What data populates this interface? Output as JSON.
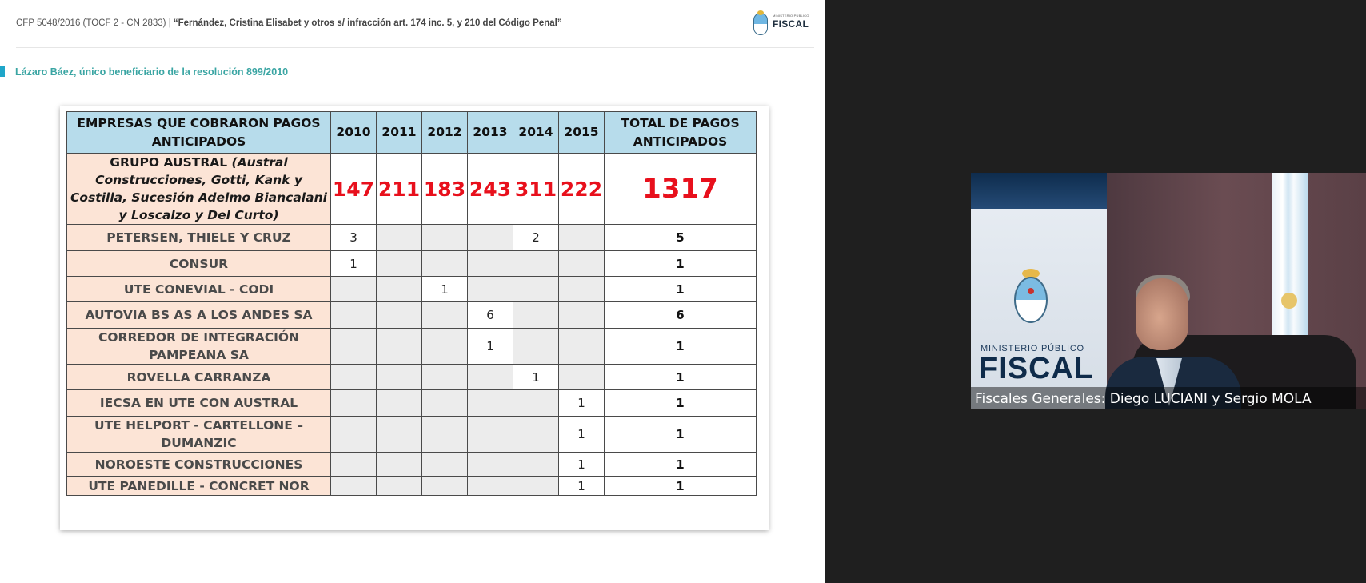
{
  "header": {
    "case_prefix": "CFP 5048/2016 (TOCF 2 - CN 2833) | ",
    "case_title": "“Fernández, Cristina Elisabet y otros s/ infracción art. 174 inc. 5, y 210 del Código Penal”",
    "logo_small_text": "MINISTERIO PÚBLICO",
    "logo_text": "FISCAL"
  },
  "section_title": "Lázaro Báez, único beneficiario de la resolución 899/2010",
  "table": {
    "col_company": "EMPRESAS QUE COBRARON PAGOS ANTICIPADOS",
    "years": [
      "2010",
      "2011",
      "2012",
      "2013",
      "2014",
      "2015"
    ],
    "col_total": "TOTAL DE PAGOS ANTICIPADOS",
    "rows": [
      {
        "company": "GRUPO AUSTRAL",
        "company_detail": "(Austral Construcciones, Gotti, Kank y Costilla, Sucesión Adelmo Biancalani y Loscalzo y Del Curto)",
        "values": [
          "147",
          "211",
          "183",
          "243",
          "311",
          "222"
        ],
        "total": "1317"
      },
      {
        "company": "PETERSEN, THIELE Y CRUZ",
        "values": [
          "3",
          "",
          "",
          "",
          "2",
          ""
        ],
        "total": "5"
      },
      {
        "company": "CONSUR",
        "values": [
          "1",
          "",
          "",
          "",
          "",
          ""
        ],
        "total": "1"
      },
      {
        "company": "UTE CONEVIAL - CODI",
        "values": [
          "",
          "",
          "1",
          "",
          "",
          ""
        ],
        "total": "1"
      },
      {
        "company": "AUTOVIA BS AS A LOS ANDES SA",
        "values": [
          "",
          "",
          "",
          "6",
          "",
          ""
        ],
        "total": "6"
      },
      {
        "company": "CORREDOR DE INTEGRACIÓN PAMPEANA SA",
        "values": [
          "",
          "",
          "",
          "1",
          "",
          ""
        ],
        "total": "1"
      },
      {
        "company": "ROVELLA CARRANZA",
        "values": [
          "",
          "",
          "",
          "",
          "1",
          ""
        ],
        "total": "1"
      },
      {
        "company": "IECSA EN UTE CON AUSTRAL",
        "values": [
          "",
          "",
          "",
          "",
          "",
          "1"
        ],
        "total": "1"
      },
      {
        "company": "UTE HELPORT - CARTELLONE – DUMANZIC",
        "values": [
          "",
          "",
          "",
          "",
          "",
          "1"
        ],
        "total": "1"
      },
      {
        "company": "NOROESTE CONSTRUCCIONES",
        "values": [
          "",
          "",
          "",
          "",
          "",
          "1"
        ],
        "total": "1"
      },
      {
        "company": "UTE PANEDILLE - CONCRET NOR",
        "values": [
          "",
          "",
          "",
          "",
          "",
          "1"
        ],
        "total": "1"
      }
    ]
  },
  "video": {
    "backdrop_small": "MINISTERIO PÚBLICO",
    "backdrop_big": "FISCAL",
    "caption": "Fiscales Generales: Diego LUCIANI y Sergio MOLA"
  }
}
